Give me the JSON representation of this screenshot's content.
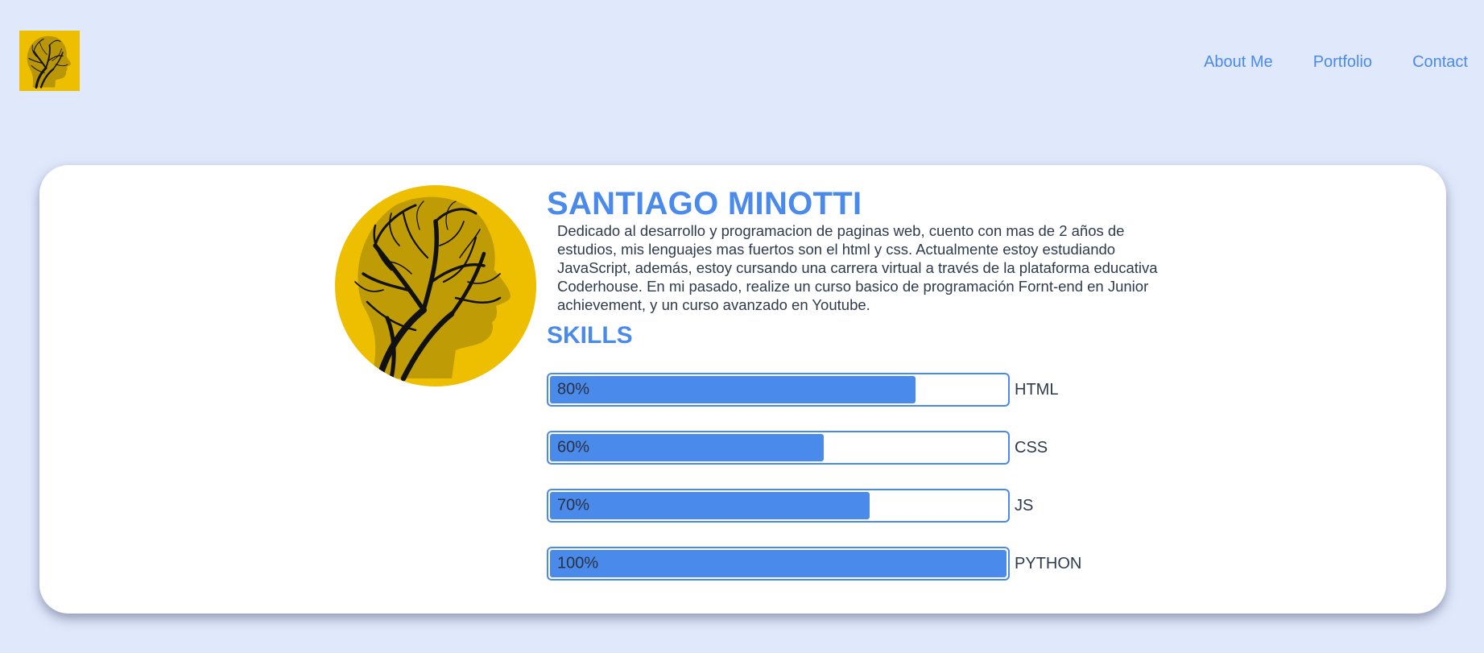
{
  "nav": {
    "items": [
      "About Me",
      "Portfolio",
      "Contact"
    ]
  },
  "profile": {
    "name": "SANTIAGO MINOTTI",
    "bio": "Dedicado al desarrollo y programacion de paginas web, cuento con mas de 2 años de estudios, mis lenguajes mas fuertos son el html y css. Actualmente estoy estudiando JavaScript, además, estoy cursando una carrera virtual a través de la plataforma educativa Coderhouse. En mi pasado, realize un curso basico de programación Fornt-end en Junior achievement, y un curso avanzado en Youtube."
  },
  "skills": {
    "title": "SKILLS",
    "items": [
      {
        "label": "HTML",
        "percent_text": "80%",
        "value": 80
      },
      {
        "label": "CSS",
        "percent_text": "60%",
        "value": 60
      },
      {
        "label": "JS",
        "percent_text": "70%",
        "value": 70
      },
      {
        "label": "PYTHON",
        "percent_text": "100%",
        "value": 100
      }
    ]
  },
  "colors": {
    "background": "#e0e8fc",
    "accent": "#4a8aea",
    "logo_yellow": "#eebf00",
    "card": "#ffffff"
  },
  "icons": {
    "logo": "head-tree-silhouette-icon",
    "avatar": "head-tree-silhouette-icon"
  }
}
